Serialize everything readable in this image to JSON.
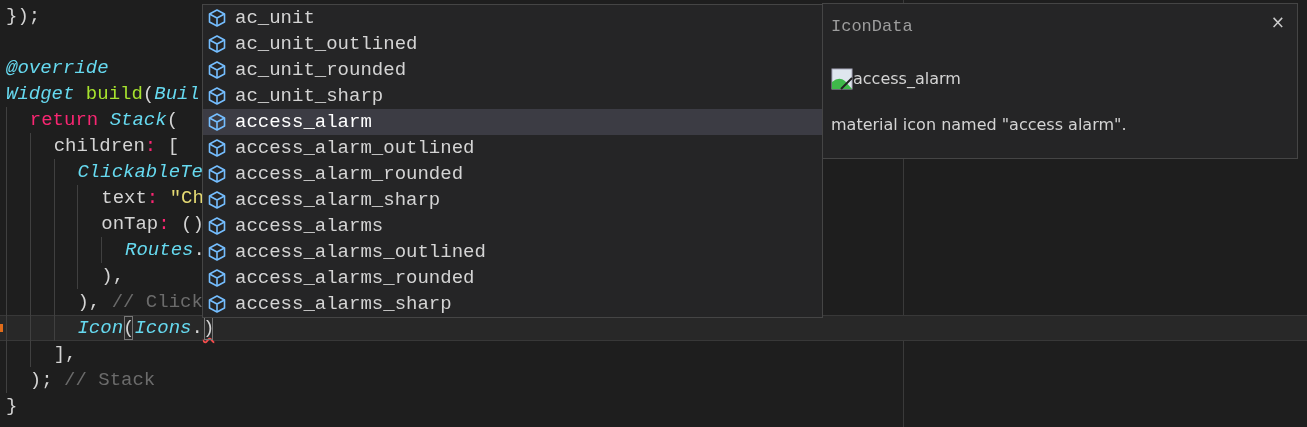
{
  "editor": {
    "blocks": [
      {
        "lines": [
          {
            "tokens": [
              {
                "text": "});",
                "kind": "plain"
              }
            ]
          }
        ]
      },
      {
        "lines": [
          {
            "tokens": [
              {
                "text": "@override",
                "kind": "type"
              }
            ]
          },
          {
            "tokens": [
              {
                "text": "Widget",
                "kind": "type"
              },
              {
                "text": " build",
                "kind": "func"
              },
              {
                "text": "(",
                "kind": "plain"
              },
              {
                "text": "Buil",
                "kind": "type"
              }
            ]
          },
          {
            "tokens": [
              {
                "text": "  return",
                "kind": "keyword"
              },
              {
                "text": " Stack",
                "kind": "type"
              },
              {
                "text": "(",
                "kind": "plain"
              }
            ]
          },
          {
            "tokens": [
              {
                "text": "    children",
                "kind": "plain"
              },
              {
                "text": ":",
                "kind": "keyword"
              },
              {
                "text": " [",
                "kind": "plain"
              }
            ]
          },
          {
            "tokens": [
              {
                "text": "      ClickableTe",
                "kind": "type"
              }
            ]
          },
          {
            "tokens": [
              {
                "text": "        text",
                "kind": "plain"
              },
              {
                "text": ":",
                "kind": "keyword"
              },
              {
                "text": " \"Ch",
                "kind": "string"
              }
            ]
          },
          {
            "tokens": [
              {
                "text": "        onTap",
                "kind": "plain"
              },
              {
                "text": ":",
                "kind": "keyword"
              },
              {
                "text": " ()",
                "kind": "plain"
              }
            ]
          },
          {
            "tokens": [
              {
                "text": "          Routes",
                "kind": "type"
              },
              {
                "text": ".",
                "kind": "plain"
              }
            ]
          },
          {
            "tokens": [
              {
                "text": "        ),",
                "kind": "plain"
              }
            ]
          },
          {
            "tokens": [
              {
                "text": "      ),",
                "kind": "plain"
              },
              {
                "text": " // Click",
                "kind": "comment"
              }
            ]
          },
          {
            "current": true,
            "gutter_mark": true,
            "tokens": [
              {
                "text": "      Icon",
                "kind": "type"
              },
              {
                "text": "(",
                "kind": "plain",
                "bracket_match": true
              },
              {
                "text": "Icons",
                "kind": "type"
              },
              {
                "text": ".",
                "kind": "plain"
              },
              {
                "text": ")",
                "kind": "plain",
                "bracket_match": true,
                "error": true
              }
            ]
          },
          {
            "tokens": [
              {
                "text": "    ],",
                "kind": "plain"
              }
            ]
          },
          {
            "tokens": [
              {
                "text": "  );",
                "kind": "plain"
              },
              {
                "text": " // Stack",
                "kind": "comment"
              }
            ]
          },
          {
            "tokens": [
              {
                "text": "}",
                "kind": "plain"
              }
            ]
          }
        ]
      }
    ]
  },
  "suggestions": [
    {
      "label": "ac_unit",
      "selected": false
    },
    {
      "label": "ac_unit_outlined",
      "selected": false
    },
    {
      "label": "ac_unit_rounded",
      "selected": false
    },
    {
      "label": "ac_unit_sharp",
      "selected": false
    },
    {
      "label": "access_alarm",
      "selected": true
    },
    {
      "label": "access_alarm_outlined",
      "selected": false
    },
    {
      "label": "access_alarm_rounded",
      "selected": false
    },
    {
      "label": "access_alarm_sharp",
      "selected": false
    },
    {
      "label": "access_alarms",
      "selected": false
    },
    {
      "label": "access_alarms_outlined",
      "selected": false
    },
    {
      "label": "access_alarms_rounded",
      "selected": false
    },
    {
      "label": "access_alarms_sharp",
      "selected": false
    }
  ],
  "details": {
    "title": "IconData",
    "close": "×",
    "image_alt": "access_alarm",
    "description": "material icon named \"access alarm\"."
  }
}
